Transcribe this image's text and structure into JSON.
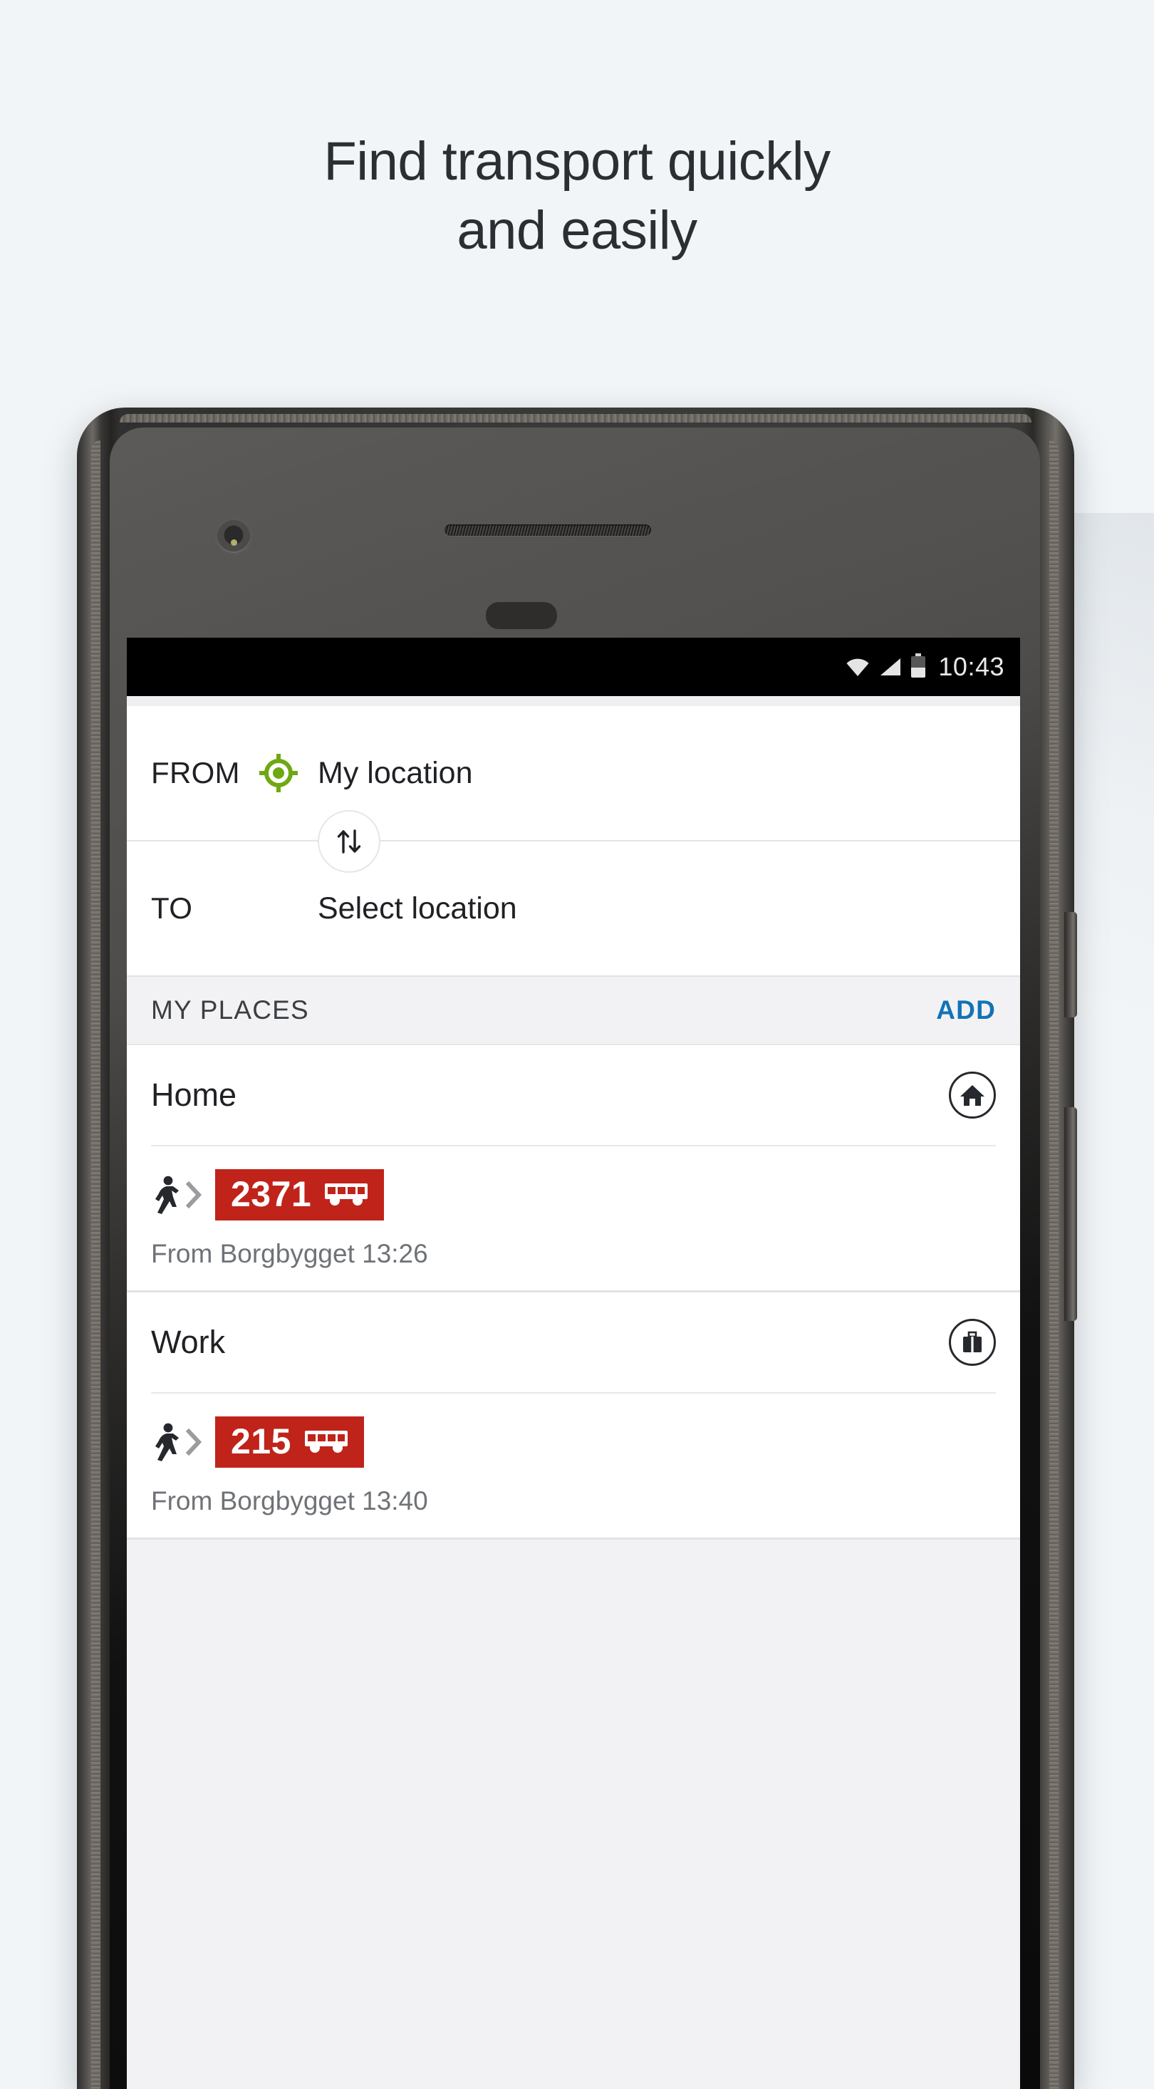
{
  "promo": {
    "headline_line1": "Find transport quickly",
    "headline_line2": "and easily",
    "background_color": "#F2F5F7",
    "text_color": "#2b2f33"
  },
  "device": {
    "name": "android-phone-mockup",
    "camera_icon": "camera-icon",
    "speaker_icon": "earpiece-speaker",
    "sensor_icon": "proximity-sensor",
    "power_button": "power-button",
    "volume_button": "volume-rocker"
  },
  "statusbar": {
    "wifi_icon": "wifi-icon",
    "signal_icon": "cellular-signal-icon",
    "battery_icon": "battery-icon",
    "battery_level_percent": 48,
    "time": "10:43",
    "background_color": "#000000",
    "text_color": "#e9e9e9"
  },
  "search_form": {
    "from": {
      "label": "FROM",
      "icon": "gps-crosshair-icon",
      "icon_color": "#6FA812",
      "value": "My location"
    },
    "to": {
      "label": "TO",
      "value": "Select location",
      "placeholder": "Select location"
    },
    "swap_button": {
      "icon": "swap-arrows-icon",
      "label": "Swap from and to"
    }
  },
  "my_places": {
    "title": "MY PLACES",
    "action_label": "ADD",
    "action_color": "#1273B5",
    "items": [
      {
        "name": "Home",
        "icon": "home-icon",
        "trip": {
          "mode_icon": "walking-person-icon",
          "chevron_icon": "chevron-right-icon",
          "line_number": "2371",
          "line_icon": "bus-icon",
          "line_color": "#C0231A",
          "departure": "From Borgbygget 13:26"
        }
      },
      {
        "name": "Work",
        "icon": "briefcase-icon",
        "trip": {
          "mode_icon": "walking-person-icon",
          "chevron_icon": "chevron-right-icon",
          "line_number": "215",
          "line_icon": "bus-icon",
          "line_color": "#C0231A",
          "departure": "From Borgbygget 13:40"
        }
      }
    ]
  }
}
